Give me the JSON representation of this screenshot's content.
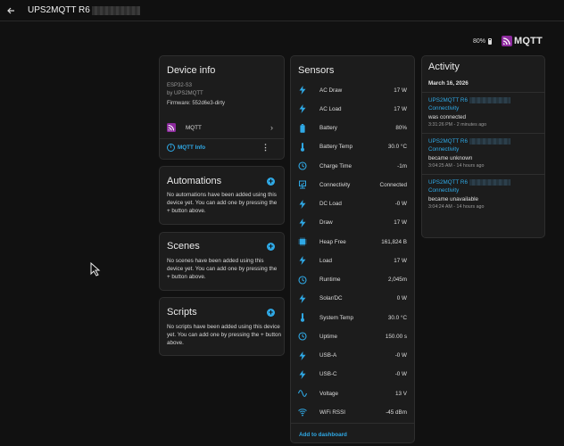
{
  "header": {
    "title": "UPS2MQTT R6"
  },
  "brand": {
    "battery_percent": "80%",
    "logo_text": "MQTT"
  },
  "device_info": {
    "title": "Device info",
    "model": "ESP32-S3",
    "manufacturer": "by UPS2MQTT",
    "firmware": "Firmware: 552d6e3-dirty",
    "integration": "MQTT",
    "info_link": "MQTT Info"
  },
  "automations": {
    "title": "Automations",
    "text": "No automations have been added using this device yet. You can add one by pressing the + button above."
  },
  "scenes": {
    "title": "Scenes",
    "text": "No scenes have been added using this device yet. You can add one by pressing the + button above."
  },
  "scripts": {
    "title": "Scripts",
    "text": "No scripts have been added using this device yet. You can add one by pressing the + button above."
  },
  "sensors": {
    "title": "Sensors",
    "add_link": "Add to dashboard",
    "items": [
      {
        "label": "AC Draw",
        "value": "17 W",
        "icon": "flash-icon"
      },
      {
        "label": "AC Load",
        "value": "17 W",
        "icon": "flash-icon"
      },
      {
        "label": "Battery",
        "value": "80%",
        "icon": "battery-icon"
      },
      {
        "label": "Battery Temp",
        "value": "30.0 °C",
        "icon": "thermometer-icon"
      },
      {
        "label": "Charge Time",
        "value": "-1m",
        "icon": "clock-icon"
      },
      {
        "label": "Connectivity",
        "value": "Connected",
        "icon": "connectivity-icon"
      },
      {
        "label": "DC Load",
        "value": "-0 W",
        "icon": "flash-icon"
      },
      {
        "label": "Draw",
        "value": "17 W",
        "icon": "flash-icon"
      },
      {
        "label": "Heap Free",
        "value": "161,824 B",
        "icon": "memory-icon"
      },
      {
        "label": "Load",
        "value": "17 W",
        "icon": "flash-icon"
      },
      {
        "label": "Runtime",
        "value": "2,045m",
        "icon": "clock-icon"
      },
      {
        "label": "Solar/DC",
        "value": "0 W",
        "icon": "flash-icon"
      },
      {
        "label": "System Temp",
        "value": "30.0 °C",
        "icon": "thermometer-icon"
      },
      {
        "label": "Uptime",
        "value": "150.00 s",
        "icon": "clock-icon"
      },
      {
        "label": "USB-A",
        "value": "-0 W",
        "icon": "flash-icon"
      },
      {
        "label": "USB-C",
        "value": "-0 W",
        "icon": "flash-icon"
      },
      {
        "label": "Voltage",
        "value": "13 V",
        "icon": "sine-wave-icon"
      },
      {
        "label": "WiFi RSSI",
        "value": "-45 dBm",
        "icon": "wifi-icon"
      }
    ]
  },
  "activity": {
    "title": "Activity",
    "date": "March 16, 2026",
    "items": [
      {
        "name": "UPS2MQTT R6",
        "entity": "Connectivity",
        "event": "was connected",
        "time": "3:31:26 PM - 2 minutes ago"
      },
      {
        "name": "UPS2MQTT R6",
        "entity": "Connectivity",
        "event": "became unknown",
        "time": "3:04:25 AM - 14 hours ago"
      },
      {
        "name": "UPS2MQTT R6",
        "entity": "Connectivity",
        "event": "became unavailable",
        "time": "3:04:24 AM - 14 hours ago"
      }
    ]
  },
  "colors": {
    "accent": "#2fa9e6",
    "background": "#111111",
    "card": "#1c1c1c",
    "mqtt_purple": "#8d2a9e"
  }
}
